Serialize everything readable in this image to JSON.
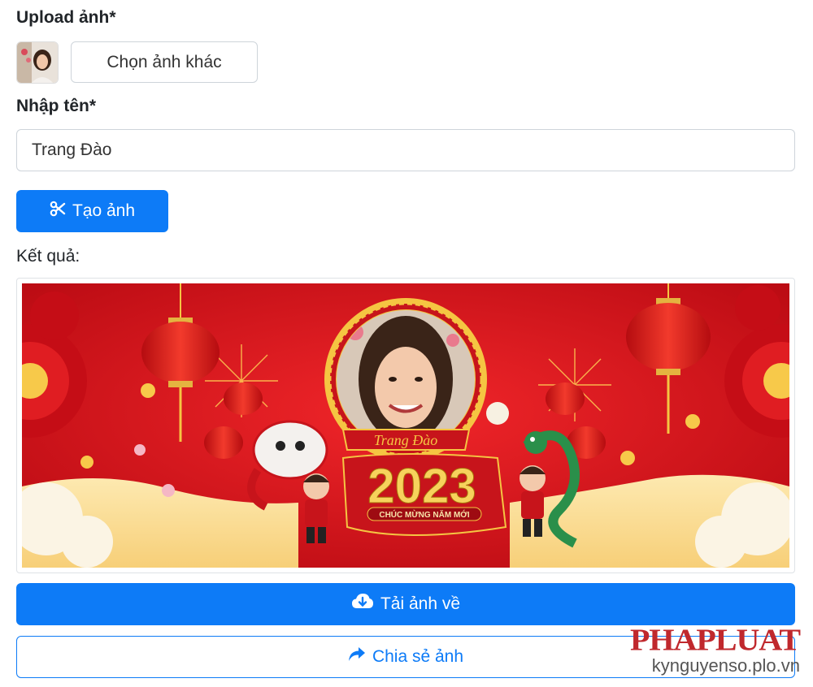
{
  "upload": {
    "label": "Upload ảnh*",
    "change_button_label": "Chọn ảnh khác"
  },
  "name": {
    "label": "Nhập tên*",
    "value": "Trang Đào"
  },
  "create_button_label": "Tạo ảnh",
  "result": {
    "label": "Kết quả:",
    "banner_name": "Trang Đào",
    "banner_year": "2023",
    "banner_greeting": "CHÚC MỪNG NĂM MỚI"
  },
  "download_button_label": "Tải ảnh về",
  "share_button_label": "Chia sẻ ảnh",
  "watermark": {
    "logo": "PHAPLUAT",
    "url": "kynguyenso.plo.vn"
  },
  "colors": {
    "primary": "#0d7bf7",
    "banner_red": "#d8111b",
    "banner_gold": "#f5c542",
    "watermark_red": "#c0282d"
  },
  "icons": [
    "scissors-icon",
    "cloud-download-icon",
    "share-arrow-icon"
  ]
}
